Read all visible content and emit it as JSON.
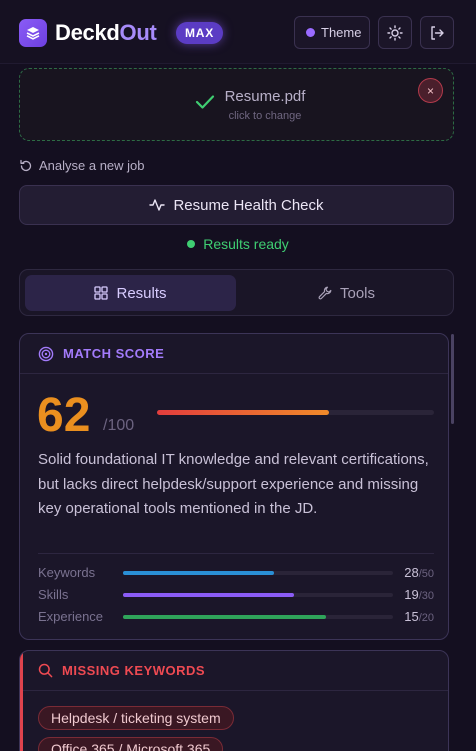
{
  "header": {
    "brand_part1": "Deckd",
    "brand_part2": "Out",
    "plan_badge": "MAX",
    "theme_label": "Theme",
    "accent_color": "#8b5cf6"
  },
  "upload": {
    "file_name": "Resume.pdf",
    "hint": "click to change",
    "close_glyph": "×"
  },
  "analyse_link": "Analyse a new job",
  "health_check_label": "Resume Health Check",
  "status": "Results ready",
  "tabs": [
    {
      "label": "Results",
      "active": true
    },
    {
      "label": "Tools",
      "active": false
    }
  ],
  "match_score": {
    "heading": "MATCH SCORE",
    "score": "62",
    "out_of": "/100",
    "score_fraction": 0.62,
    "summary": "Solid foundational IT knowledge and relevant certifications, but lacks direct helpdesk/support experience and missing key operational tools mentioned in the JD.",
    "metrics": [
      {
        "label": "Keywords",
        "value": "28",
        "max": "/50",
        "fraction": 0.56,
        "color": "#2a8fd6"
      },
      {
        "label": "Skills",
        "value": "19",
        "max": "/30",
        "fraction": 0.633,
        "color": "#8b5cf6"
      },
      {
        "label": "Experience",
        "value": "15",
        "max": "/20",
        "fraction": 0.75,
        "color": "#2fa45a"
      }
    ]
  },
  "missing_keywords": {
    "heading": "MISSING KEYWORDS",
    "chips": [
      "Helpdesk / ticketing system",
      "Office 365 / Microsoft 365"
    ]
  }
}
